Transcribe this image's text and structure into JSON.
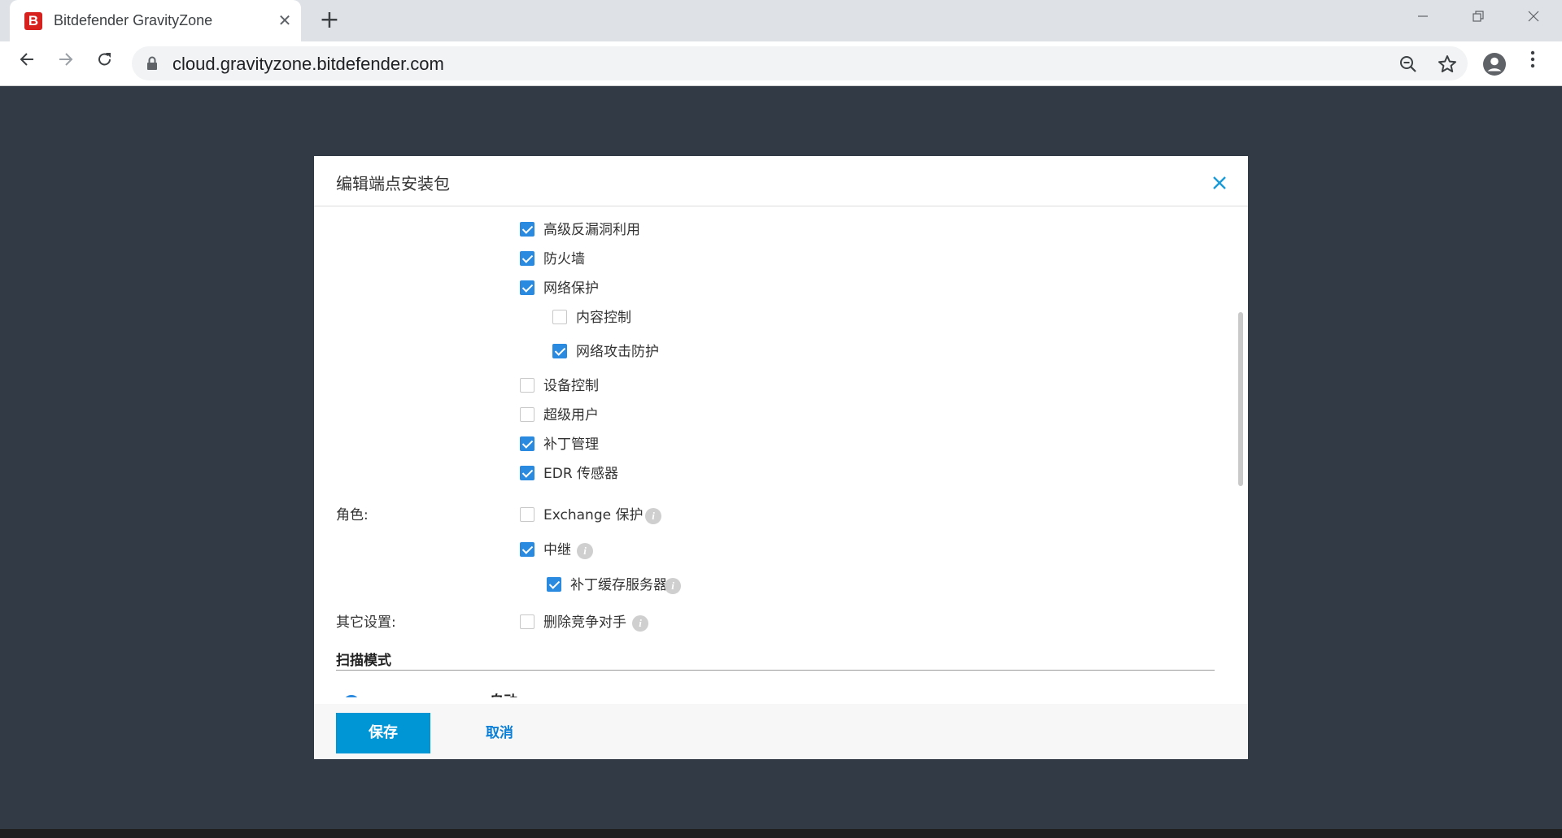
{
  "browser": {
    "tab_favicon_letter": "B",
    "tab_title": "Bitdefender GravityZone",
    "tab_close": "✕",
    "new_tab": "+",
    "url": "cloud.gravityzone.bitdefender.com",
    "brand_color": "#d6211f"
  },
  "dialog": {
    "title": "编辑端点安装包",
    "modules": [
      {
        "label": "高级反漏洞利用",
        "checked": true
      },
      {
        "label": "防火墙",
        "checked": true
      },
      {
        "label": "网络保护",
        "checked": true
      },
      {
        "label": "内容控制",
        "checked": false
      },
      {
        "label": "网络攻击防护",
        "checked": true
      },
      {
        "label": "设备控制",
        "checked": false
      },
      {
        "label": "超级用户",
        "checked": false
      },
      {
        "label": "补丁管理",
        "checked": true
      },
      {
        "label": "EDR 传感器",
        "checked": true
      }
    ],
    "roles_label": "角色:",
    "roles": [
      {
        "label": "Exchange 保护",
        "checked": false
      },
      {
        "label": "中继",
        "checked": true
      },
      {
        "label": "补丁缓存服务器",
        "checked": true
      }
    ],
    "other_label": "其它设置:",
    "other": [
      {
        "label": "删除竞争对手",
        "checked": false
      }
    ],
    "scan_mode_title": "扫描模式",
    "scan_radio_label": "自动",
    "scan_mode_value": "自动",
    "save_label": "保存",
    "cancel_label": "取消",
    "accent_color": "#0096d6",
    "info_glyph": "i"
  }
}
